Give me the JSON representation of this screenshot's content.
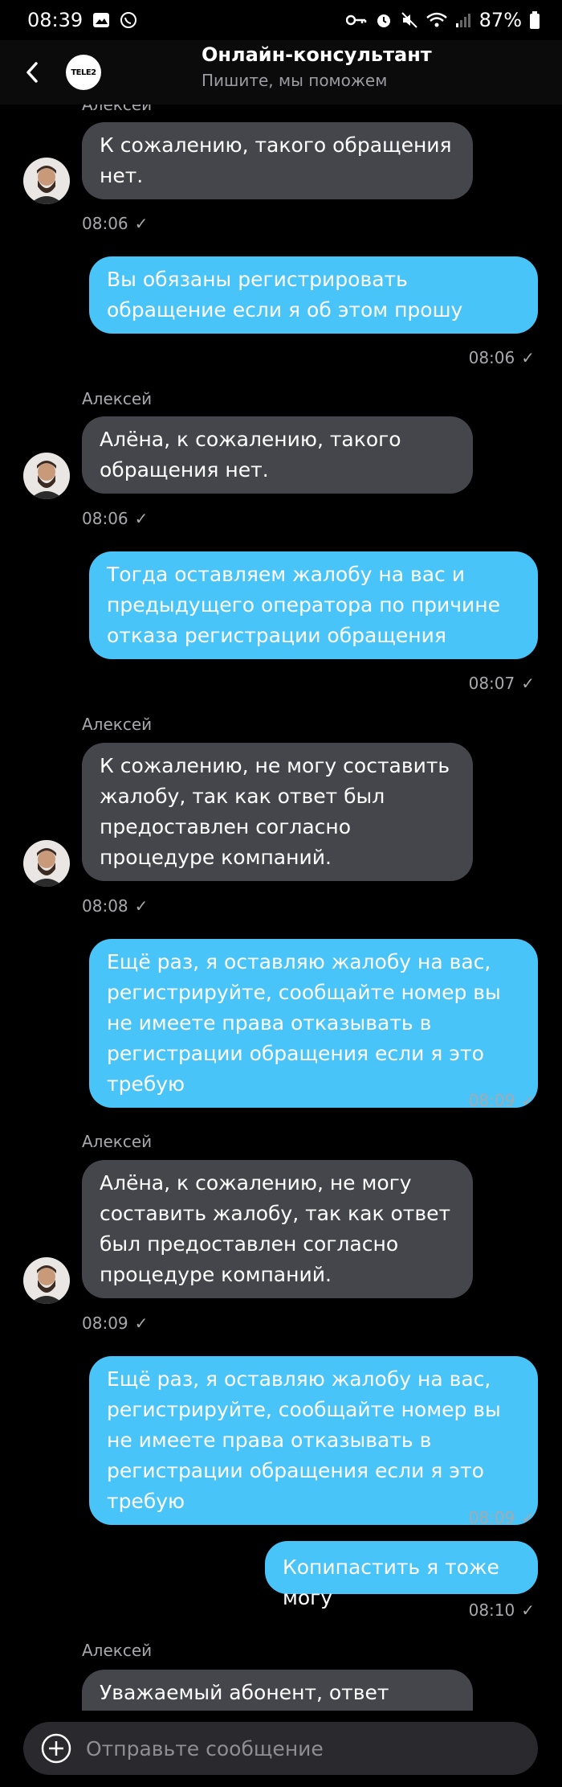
{
  "status_bar": {
    "time": "08:39",
    "battery": "87%"
  },
  "header": {
    "title": "Онлайн-консультант",
    "subtitle": "Пишите, мы поможем",
    "logo_text": "TELE2"
  },
  "messages": [
    {
      "direction": "in",
      "sender": "Алексей",
      "text": "К сожалению, такого обращения нет.",
      "time": "08:06",
      "status": "✓"
    },
    {
      "direction": "out",
      "text": "Вы обязаны регистрировать обращение если я об этом прошу",
      "time": "08:06",
      "status": "✓"
    },
    {
      "direction": "in",
      "sender": "Алексей",
      "text": "Алёна, к сожалению, такого обращения нет.",
      "time": "08:06",
      "status": "✓"
    },
    {
      "direction": "out",
      "text": "Тогда оставляем жалобу на вас и предыдущего оператора по причине отказа регистрации обращения",
      "time": "08:07",
      "status": "✓"
    },
    {
      "direction": "in",
      "sender": "Алексей",
      "text": "К сожалению, не могу составить жалобу, так как ответ был предоставлен согласно процедуре компаний.",
      "time": "08:08",
      "status": "✓"
    },
    {
      "direction": "out",
      "text": "Ещё раз, я оставляю жалобу на вас, регистрируйте, сообщайте номер вы не имеете права отказывать в регистрации обращения если я это требую",
      "time": "08:09",
      "status": "✓"
    },
    {
      "direction": "in",
      "sender": "Алексей",
      "text": "Алёна, к сожалению, не могу составить жалобу, так как ответ был предоставлен согласно процедуре компаний.",
      "time": "08:09",
      "status": "✓"
    },
    {
      "direction": "out",
      "text": "Ещё раз, я оставляю жалобу на вас, регистрируйте, сообщайте номер вы не имеете права отказывать в регистрации обращения если я это требую",
      "time": "08:09",
      "status": "✓"
    },
    {
      "direction": "out",
      "text": "Копипастить я тоже могу",
      "time": "08:10",
      "status": "✓"
    },
    {
      "direction": "in",
      "sender": "Алексей",
      "text": "Уважаемый абонент, ответ"
    }
  ],
  "input": {
    "placeholder": "Отправьте сообщение"
  },
  "colors": {
    "incoming_bubble": "#45464c",
    "outgoing_bubble": "#48c4f8",
    "background": "#000000",
    "input_bg": "#2a2a2e"
  }
}
